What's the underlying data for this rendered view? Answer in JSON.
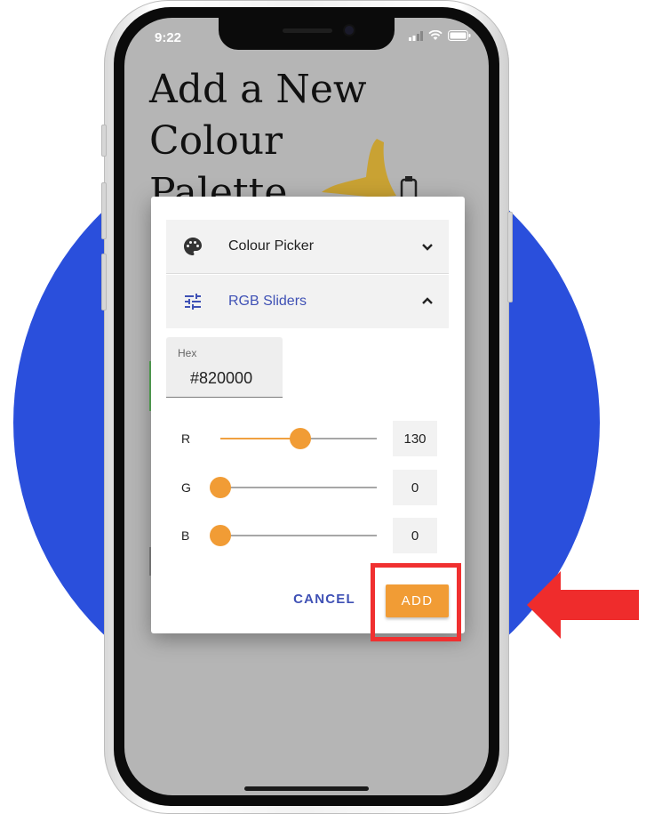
{
  "status_bar": {
    "time": "9:22"
  },
  "page": {
    "title_lines": [
      "Add a New",
      "Colour",
      "Palette"
    ]
  },
  "dialog": {
    "panels": [
      {
        "label": "Colour Picker",
        "icon": "palette-icon",
        "expanded": false
      },
      {
        "label": "RGB Sliders",
        "icon": "tune-sliders-icon",
        "expanded": true
      }
    ],
    "hex": {
      "label": "Hex",
      "value": "#820000"
    },
    "sliders": [
      {
        "label": "R",
        "value": "130",
        "fraction": 0.51
      },
      {
        "label": "G",
        "value": "0",
        "fraction": 0
      },
      {
        "label": "B",
        "value": "0",
        "fraction": 0
      }
    ],
    "actions": {
      "cancel_label": "CANCEL",
      "add_label": "ADD"
    }
  },
  "colors": {
    "accent": "#f19c35",
    "link": "#3f51b5",
    "background_circle": "#2a4fdc",
    "highlight": "#f03030"
  }
}
